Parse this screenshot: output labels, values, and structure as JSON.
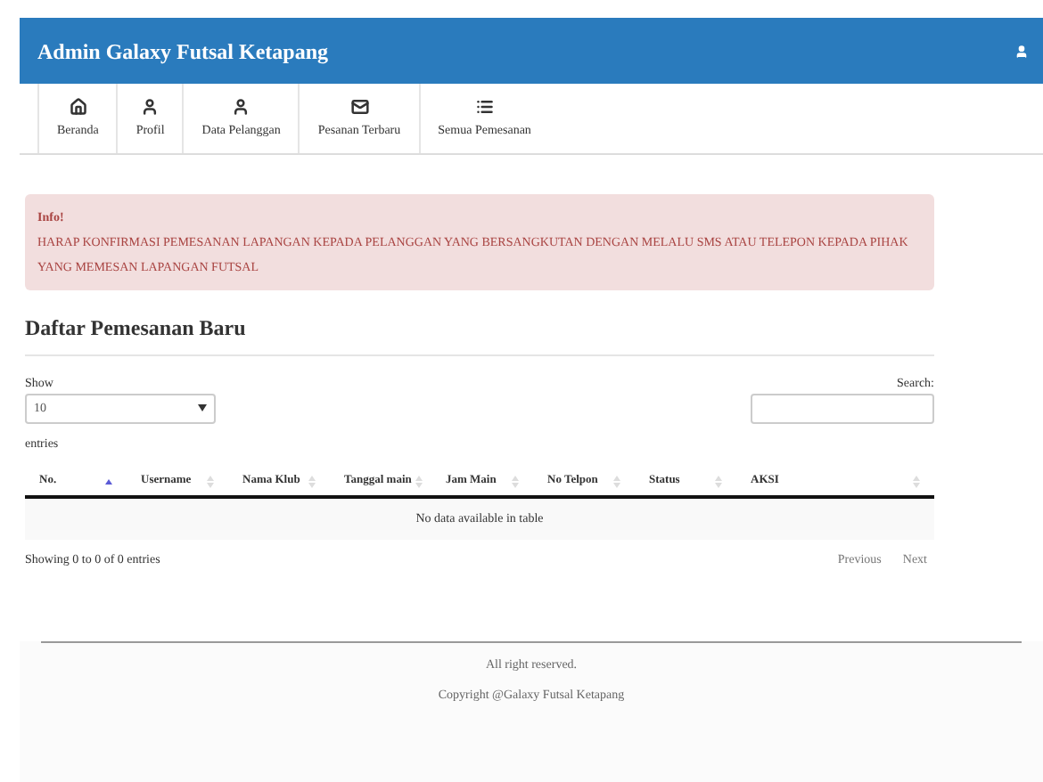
{
  "header": {
    "title": "Admin Galaxy Futsal Ketapang"
  },
  "nav": [
    {
      "label": "Beranda"
    },
    {
      "label": "Profil"
    },
    {
      "label": "Data Pelanggan"
    },
    {
      "label": "Pesanan Terbaru"
    },
    {
      "label": "Semua Pemesanan"
    }
  ],
  "alert": {
    "title": "Info!",
    "message": "HARAP KONFIRMASI PEMESANAN LAPANGAN KEPADA PELANGGAN YANG BERSANGKUTAN DENGAN MELALU SMS ATAU TELEPON KEPADA PIHAK YANG MEMESAN LAPANGAN FUTSAL"
  },
  "section_title": "Daftar Pemesanan Baru",
  "length": {
    "label_before": "Show",
    "value": "10",
    "label_after": "entries"
  },
  "search": {
    "label": "Search:"
  },
  "table": {
    "columns": [
      {
        "label": "No.",
        "selected": true
      },
      {
        "label": "Username",
        "selected": false
      },
      {
        "label": "Nama Klub",
        "selected": false
      },
      {
        "label": "Tanggal main",
        "selected": false
      },
      {
        "label": "Jam Main",
        "selected": false
      },
      {
        "label": "No Telpon",
        "selected": false
      },
      {
        "label": "Status",
        "selected": false
      },
      {
        "label": "AKSI",
        "selected": false
      }
    ],
    "empty": "No data available in table"
  },
  "info": "Showing 0 to 0 of 0 entries",
  "pagination": [
    "Previous",
    "Next"
  ],
  "footer": [
    "All right reserved.",
    "Copyright @Galaxy Futsal Ketapang"
  ]
}
